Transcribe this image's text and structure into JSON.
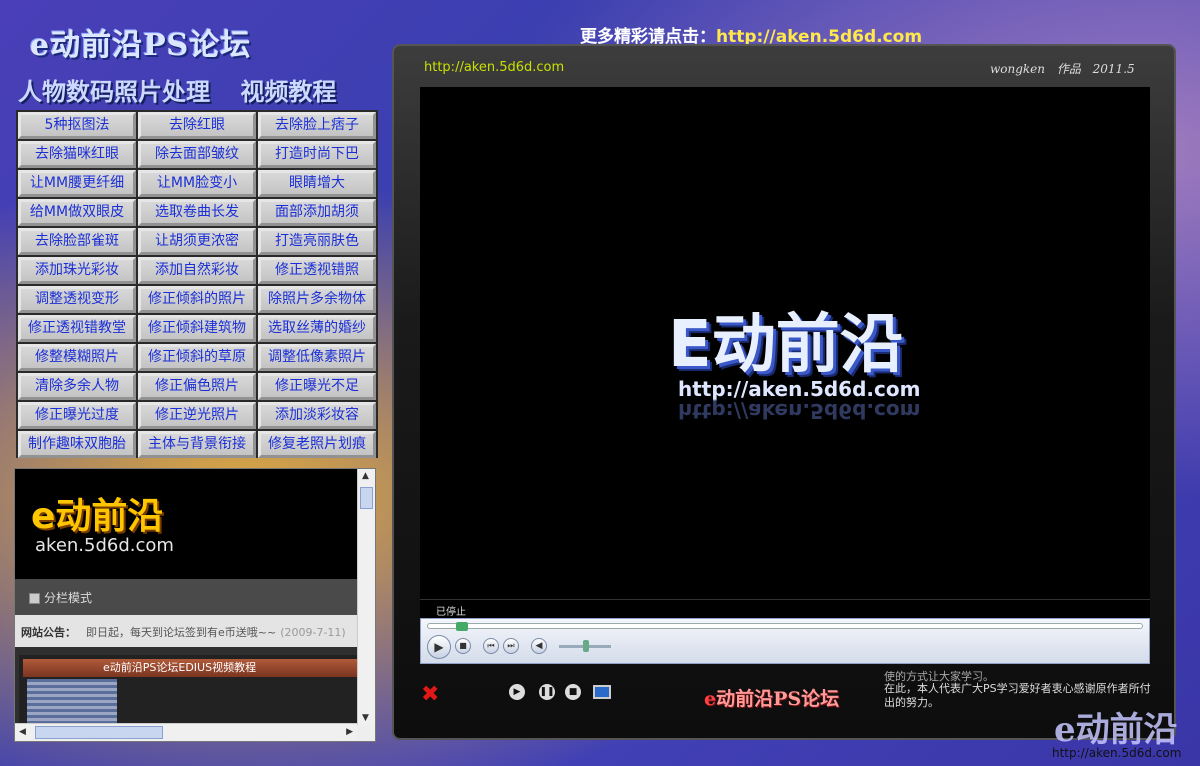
{
  "header": {
    "site_title": "e动前沿PS论坛",
    "subtitle_left": "人物数码照片处理",
    "subtitle_right": "视频教程",
    "more_prompt": "更多精彩请点击：",
    "more_url": "http://aken.5d6d.com"
  },
  "tutorials": [
    "5种抠图法",
    "去除红眼",
    "去除脸上痞子",
    "去除猫咪红眼",
    "除去面部皱纹",
    "打造时尚下巴",
    "让MM腰更纤细",
    "让MM脸变小",
    "眼睛增大",
    "给MM做双眼皮",
    "选取卷曲长发",
    "面部添加胡须",
    "去除脸部雀斑",
    "让胡须更浓密",
    "打造亮丽肤色",
    "添加珠光彩妆",
    "添加自然彩妆",
    "修正透视错照",
    "调整透视变形",
    "修正倾斜的照片",
    "除照片多余物体",
    "修正透视错教堂",
    "修正倾斜建筑物",
    "选取丝薄的婚纱",
    "修整模糊照片",
    "修正倾斜的草原",
    "调整低像素照片",
    "清除多余人物",
    "修正偏色照片",
    "修正曝光不足",
    "修正曝光过度",
    "修正逆光照片",
    "添加淡彩妆容",
    "制作趣味双胞胎",
    "主体与背景衔接",
    "修复老照片划痕"
  ],
  "forum": {
    "logo_big": "e动前沿",
    "logo_small": "aken.5d6d.com",
    "mode_label": "分栏模式",
    "notice_label": "网站公告：",
    "notice_text": "即日起，每天到论坛签到有e币送哦~~",
    "notice_date": "(2009-7-11)",
    "thumb_title": "e动前沿PS论坛EDIUS视频教程"
  },
  "player": {
    "url": "http://aken.5d6d.com",
    "author": "wongken 作品",
    "date": "2011.5",
    "video_logo": "E动前沿",
    "video_url": "http://aken.5d6d.com",
    "status": "已停止",
    "forum_name_e": "e",
    "forum_name": "动前沿PS论坛",
    "credit_cut": "使的方式让大家学习。",
    "credit_text": "在此，本人代表广大PS学习爱好者衷心感谢原作者所付出的努力。"
  },
  "watermark": {
    "logo": "e动前沿",
    "url": "http://aken.5d6d.com"
  },
  "colors": {
    "grid_button_text": "#1b2fd6",
    "accent_url": "#ffe94a",
    "close_red": "#e01818"
  }
}
